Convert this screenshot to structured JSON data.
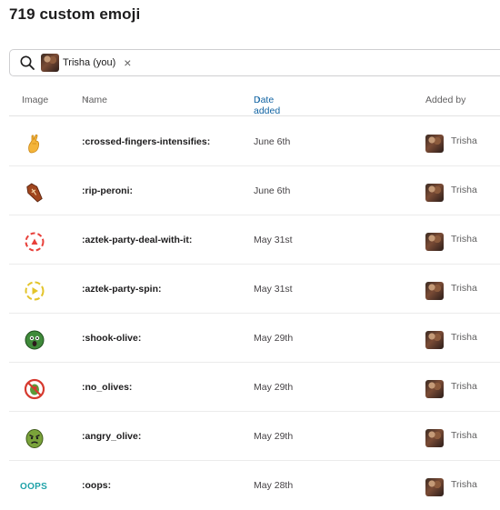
{
  "title": "719 custom emoji",
  "search": {
    "chip_label": "Trisha (you)",
    "chip_remove": "×"
  },
  "columns": {
    "image": "Image",
    "name": "Name",
    "date_added": "Date added",
    "added_by": "Added by",
    "sort_arrow": "↑"
  },
  "rows": [
    {
      "name": ":crossed-fingers-intensifies:",
      "date": "June 6th",
      "added_by": "Trisha",
      "icon": "crossed-fingers-icon"
    },
    {
      "name": ":rip-peroni:",
      "date": "June 6th",
      "added_by": "Trisha",
      "icon": "coffin-icon"
    },
    {
      "name": ":aztek-party-deal-with-it:",
      "date": "May 31st",
      "added_by": "Trisha",
      "icon": "aztek-party-icon"
    },
    {
      "name": ":aztek-party-spin:",
      "date": "May 31st",
      "added_by": "Trisha",
      "icon": "aztek-spin-icon"
    },
    {
      "name": ":shook-olive:",
      "date": "May 29th",
      "added_by": "Trisha",
      "icon": "shook-olive-icon"
    },
    {
      "name": ":no_olives:",
      "date": "May 29th",
      "added_by": "Trisha",
      "icon": "no-olives-icon"
    },
    {
      "name": ":angry_olive:",
      "date": "May 29th",
      "added_by": "Trisha",
      "icon": "angry-olive-icon"
    },
    {
      "name": ":oops:",
      "date": "May 28th",
      "added_by": "Trisha",
      "icon": "oops-icon",
      "icon_text": "OOPS"
    }
  ],
  "colors": {
    "sorted_column": "#1264a3",
    "oops_teal": "#1fa2a8"
  }
}
